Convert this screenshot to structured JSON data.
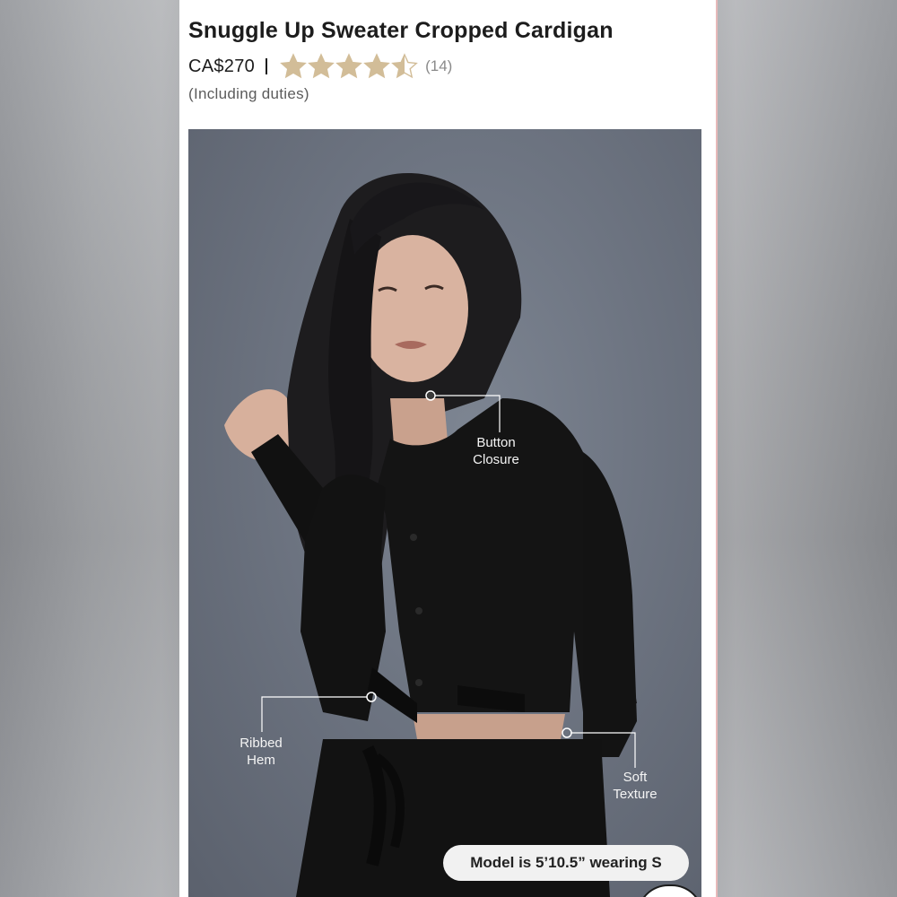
{
  "product": {
    "title": "Snuggle Up Sweater Cropped Cardigan",
    "price": "CA$270",
    "rating": 4.5,
    "rating_max": 5,
    "review_count": "(14)",
    "duties_note": "(Including duties)",
    "star_color": "#d2bd98"
  },
  "image": {
    "callouts": {
      "button_closure": [
        "Button",
        "Closure"
      ],
      "ribbed_hem": [
        "Ribbed",
        "Hem"
      ],
      "soft_texture": [
        "Soft",
        "Texture"
      ]
    },
    "model_info": "Model is 5’10.5” wearing S"
  }
}
